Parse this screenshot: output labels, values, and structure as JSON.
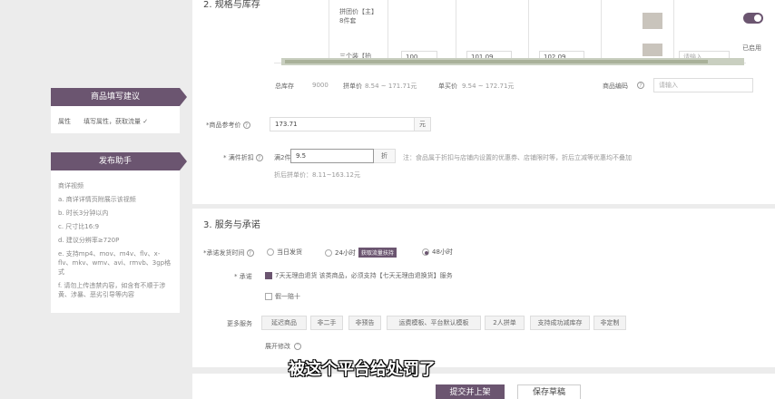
{
  "tips_panel": {
    "title": "商品填写建议",
    "attr_label": "属性",
    "attr_status": "填写属性，获取流量 ✓"
  },
  "assist_panel": {
    "title": "发布助手",
    "lines": [
      "商详视频",
      "a. 商详详情页附展示该视频",
      "b. 时长3分钟以内",
      "c. 尺寸比16:9",
      "d. 建议分辨率≥720P",
      "e. 支持mp4、mov、m4v、flv、x-flv、mkv、wmv、avi、rmvb、3gp格式",
      "f. 请勿上传违禁内容，如含有不顺于涉黄、涉暴、恶劣引导等内容"
    ]
  },
  "section2": {
    "title": "2. 规格与库存",
    "sku_row1_name": "拼团价【主】\n8件套",
    "sku_row2_name": "三个装【拍",
    "sku_row2_values": [
      "100",
      "101.09",
      "102.09"
    ],
    "sku_placeholder": "请输入",
    "status_label": "已启用",
    "total_stock_label": "总库存",
    "total_stock_value": "9000",
    "group_price_label": "拼单价",
    "group_price_value": "8.54 ~ 171.71元",
    "single_price_label": "单买价",
    "single_price_value": "9.54 ~ 172.71元",
    "product_code_label": "商品编码",
    "product_code_placeholder": "请输入"
  },
  "ref_price": {
    "label": "*商品参考价",
    "value": "173.71",
    "unit": "元"
  },
  "full_discount": {
    "label": "* 满件折扣",
    "prefix": "满2件",
    "value": "9.5",
    "unit": "折",
    "note": "注：食品属于折扣与店铺内设置的优惠券、店铺限时等，折后立减等优惠均不叠加",
    "result": "折后拼单价：8.11~163.12元"
  },
  "section3": {
    "title": "3. 服务与承诺",
    "ship_label": "*承诺发货时间",
    "ship_options": [
      {
        "label": "当日发货",
        "selected": false
      },
      {
        "label": "24小时",
        "selected": false,
        "tag": "获取流量扶持"
      },
      {
        "label": "48小时",
        "selected": true
      }
    ],
    "promise_label": "* 承诺",
    "promise_items": [
      {
        "label": "7天无理由退货  该类商品，必须支持【七天无理由退换货】服务",
        "checked": true
      },
      {
        "label": "假一赔十",
        "checked": false
      }
    ],
    "more_label": "更多服务",
    "services": [
      "延迟商品",
      "非二手",
      "非预告",
      "运费模板、平台默认模板",
      "2人拼单",
      "支持成功减库存",
      "非定制"
    ],
    "expand_label": "展开修改"
  },
  "actions": {
    "submit": "提交并上架",
    "save": "保存草稿"
  },
  "subtitle": "被这个平台给处罚了"
}
